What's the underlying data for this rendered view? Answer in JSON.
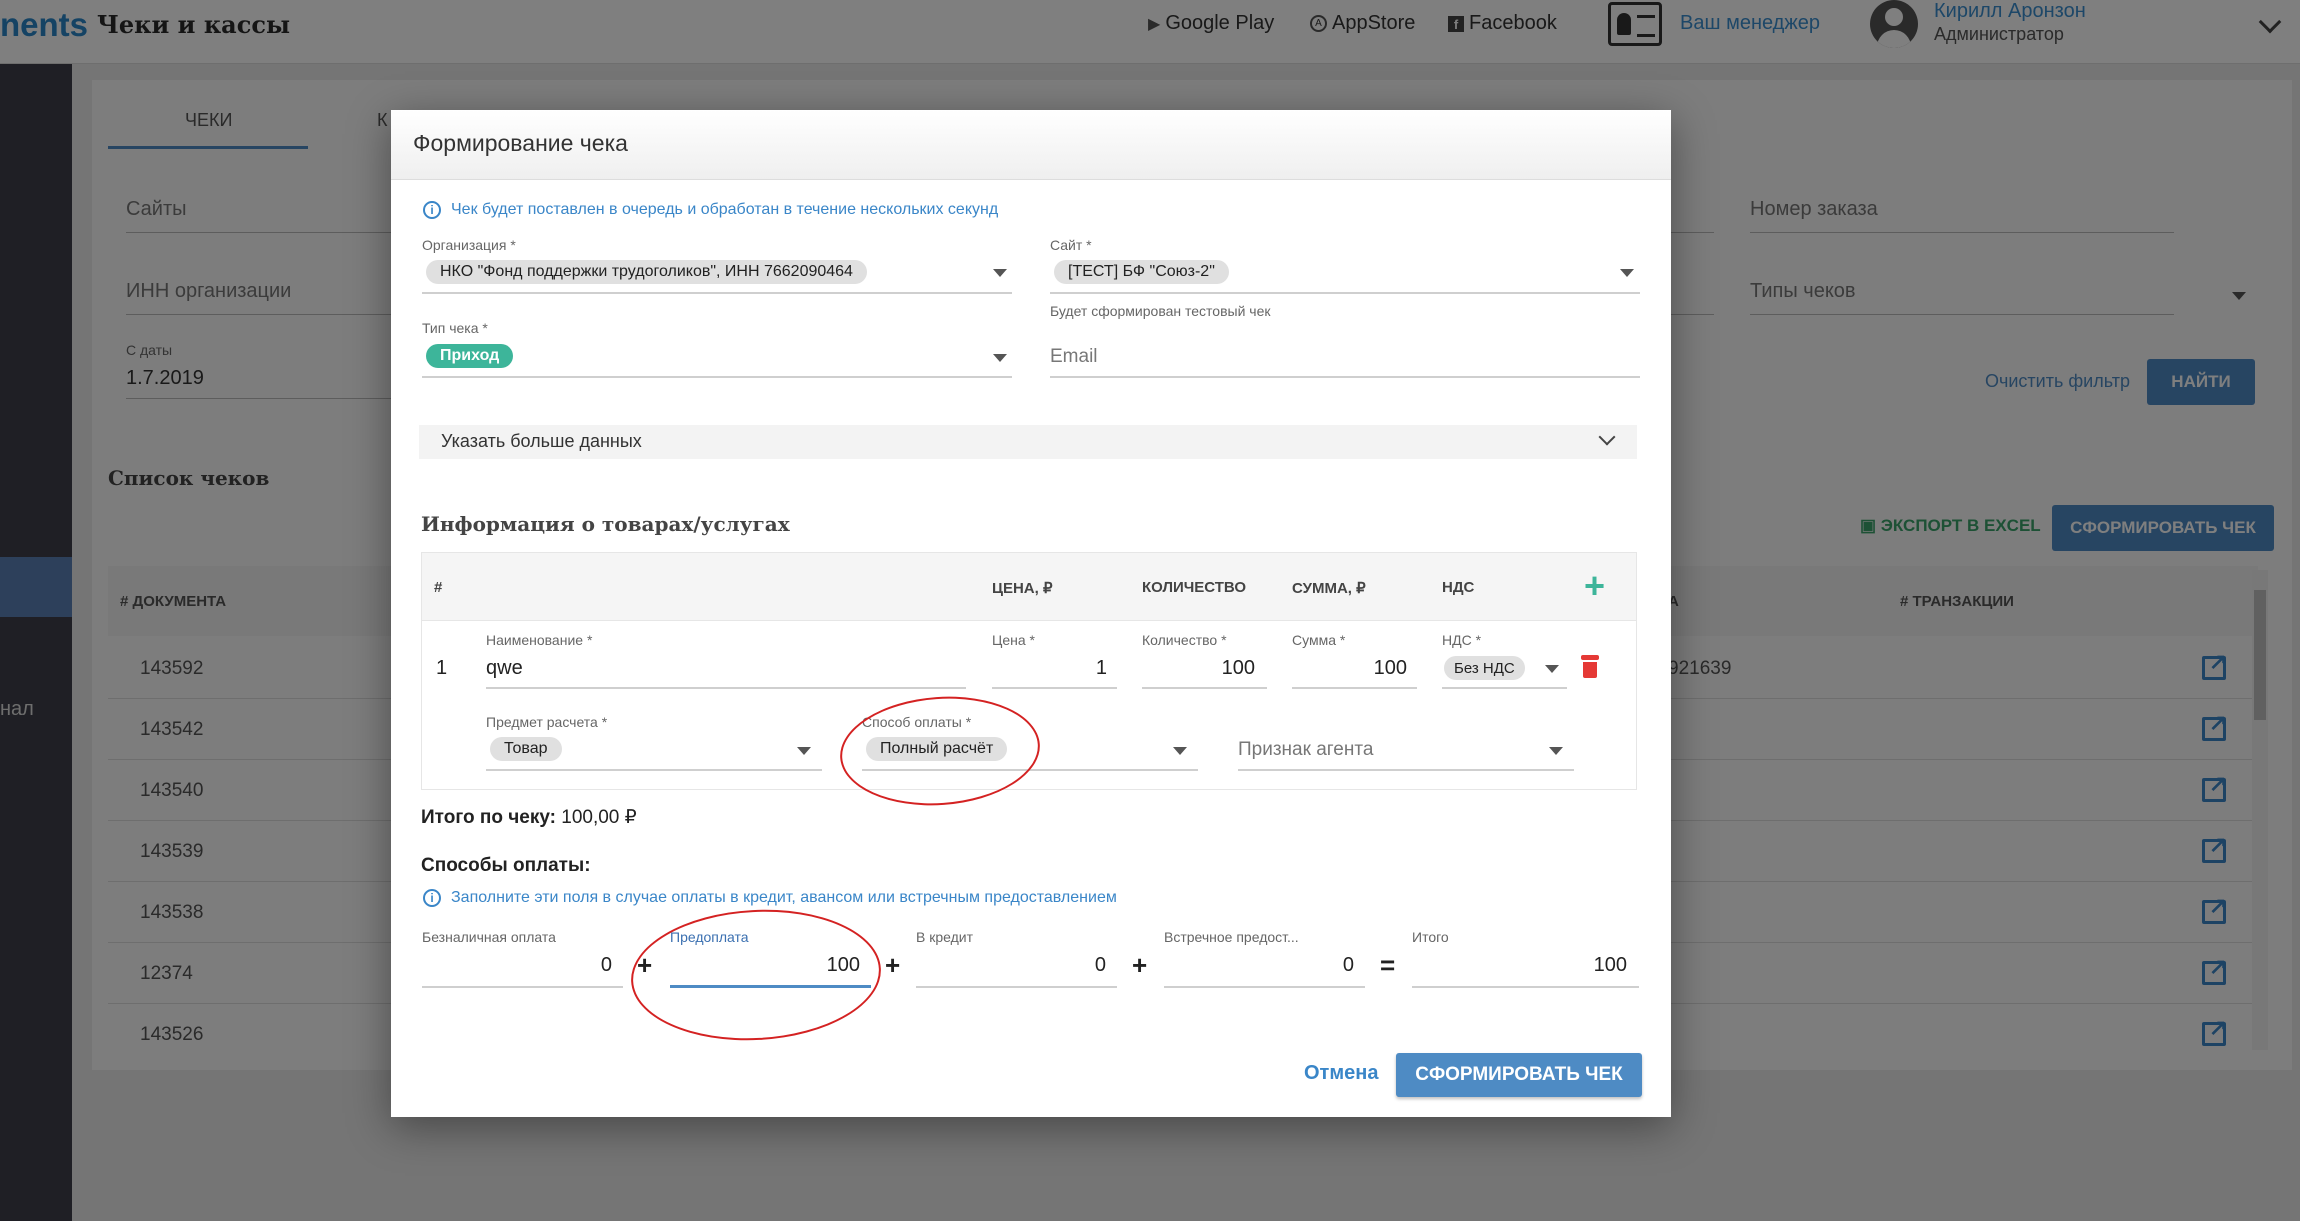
{
  "header": {
    "brand": "nents",
    "page_title": "Чеки и кассы",
    "links": [
      {
        "label": "Google Play",
        "icon": "play-icon"
      },
      {
        "label": "AppStore",
        "icon": "appstore-icon"
      },
      {
        "label": "Facebook",
        "icon": "facebook-icon"
      }
    ],
    "manager_label": "Ваш менеджер",
    "user_name": "Кирилл Аронзон",
    "user_role": "Администратор"
  },
  "sidebar": {
    "partial_item": "нал"
  },
  "background": {
    "tabs": [
      "ЧЕКИ",
      "К"
    ],
    "filters": {
      "sites": "Сайты",
      "inn": "ИНН организации",
      "date_from_label": "С даты",
      "date_from_value": "1.7.2019",
      "order_number": "Номер заказа",
      "check_types": "Типы чеков"
    },
    "clear_filter": "Очистить фильтр",
    "find_button": "НАЙТИ",
    "list_title": "Список чеков",
    "export_excel": "ЭКСПОРТ В EXCEL",
    "form_check_button": "СФОРМИРОВАТЬ ЧЕК",
    "columns": [
      "# ДОКУМЕНТА",
      "# ТРАНЗАКЦИИ"
    ],
    "partial_header": "А",
    "rows": [
      {
        "doc": "143592",
        "extra": "921639"
      },
      {
        "doc": "143542",
        "extra": ""
      },
      {
        "doc": "143540",
        "extra": ""
      },
      {
        "doc": "143539",
        "extra": ""
      },
      {
        "doc": "143538",
        "extra": ""
      },
      {
        "doc": "12374",
        "extra": ""
      },
      {
        "doc": "143526",
        "extra": ""
      }
    ]
  },
  "modal": {
    "title": "Формирование чека",
    "info": "Чек будет поставлен в очередь и обработан в течение нескольких секунд",
    "organization": {
      "label": "Организация *",
      "value": "НКО \"Фонд поддержки трудоголиков\", ИНН 7662090464"
    },
    "site": {
      "label": "Сайт *",
      "value": "[ТЕСТ] БФ \"Союз-2\"",
      "hint": "Будет сформирован тестовый чек"
    },
    "check_type": {
      "label": "Тип чека *",
      "value": "Приход"
    },
    "email": {
      "placeholder": "Email"
    },
    "more_data": "Указать больше данных",
    "goods_title": "Информация о товарах/услугах",
    "goods_headers": {
      "num": "#",
      "price": "ЦЕНА, ₽",
      "qty": "КОЛИЧЕСТВО",
      "sum": "СУММА, ₽",
      "vat": "НДС"
    },
    "item": {
      "index": "1",
      "name_label": "Наименование *",
      "name_value": "qwe",
      "price_label": "Цена *",
      "price_value": "1",
      "qty_label": "Количество *",
      "qty_value": "100",
      "sum_label": "Сумма *",
      "sum_value": "100",
      "vat_label": "НДС *",
      "vat_value": "Без НДС",
      "subject_label": "Предмет расчета *",
      "subject_value": "Товар",
      "method_label": "Способ оплаты *",
      "method_value": "Полный расчёт",
      "agent_placeholder": "Признак агента"
    },
    "total_label": "Итого по чеку:",
    "total_value": "100,00 ₽",
    "payments_title": "Способы оплаты:",
    "payments_info": "Заполните эти поля в случае оплаты в кредит, авансом или встречным предоставлением",
    "payments": {
      "cashless_label": "Безналичная оплата",
      "cashless_value": "0",
      "prepay_label": "Предоплата",
      "prepay_value": "100",
      "credit_label": "В кредит",
      "credit_value": "0",
      "counter_label": "Встречное предост...",
      "counter_value": "0",
      "total_label": "Итого",
      "total_value": "100"
    },
    "ops": {
      "plus": "+",
      "eq": "="
    },
    "cancel": "Отмена",
    "submit": "СФОРМИРОВАТЬ ЧЕК"
  },
  "colors": {
    "accent": "#4e8bc4",
    "link": "#3a86c8",
    "green_chip": "#3db59a",
    "danger": "#e53935",
    "annotation": "#d42222"
  }
}
